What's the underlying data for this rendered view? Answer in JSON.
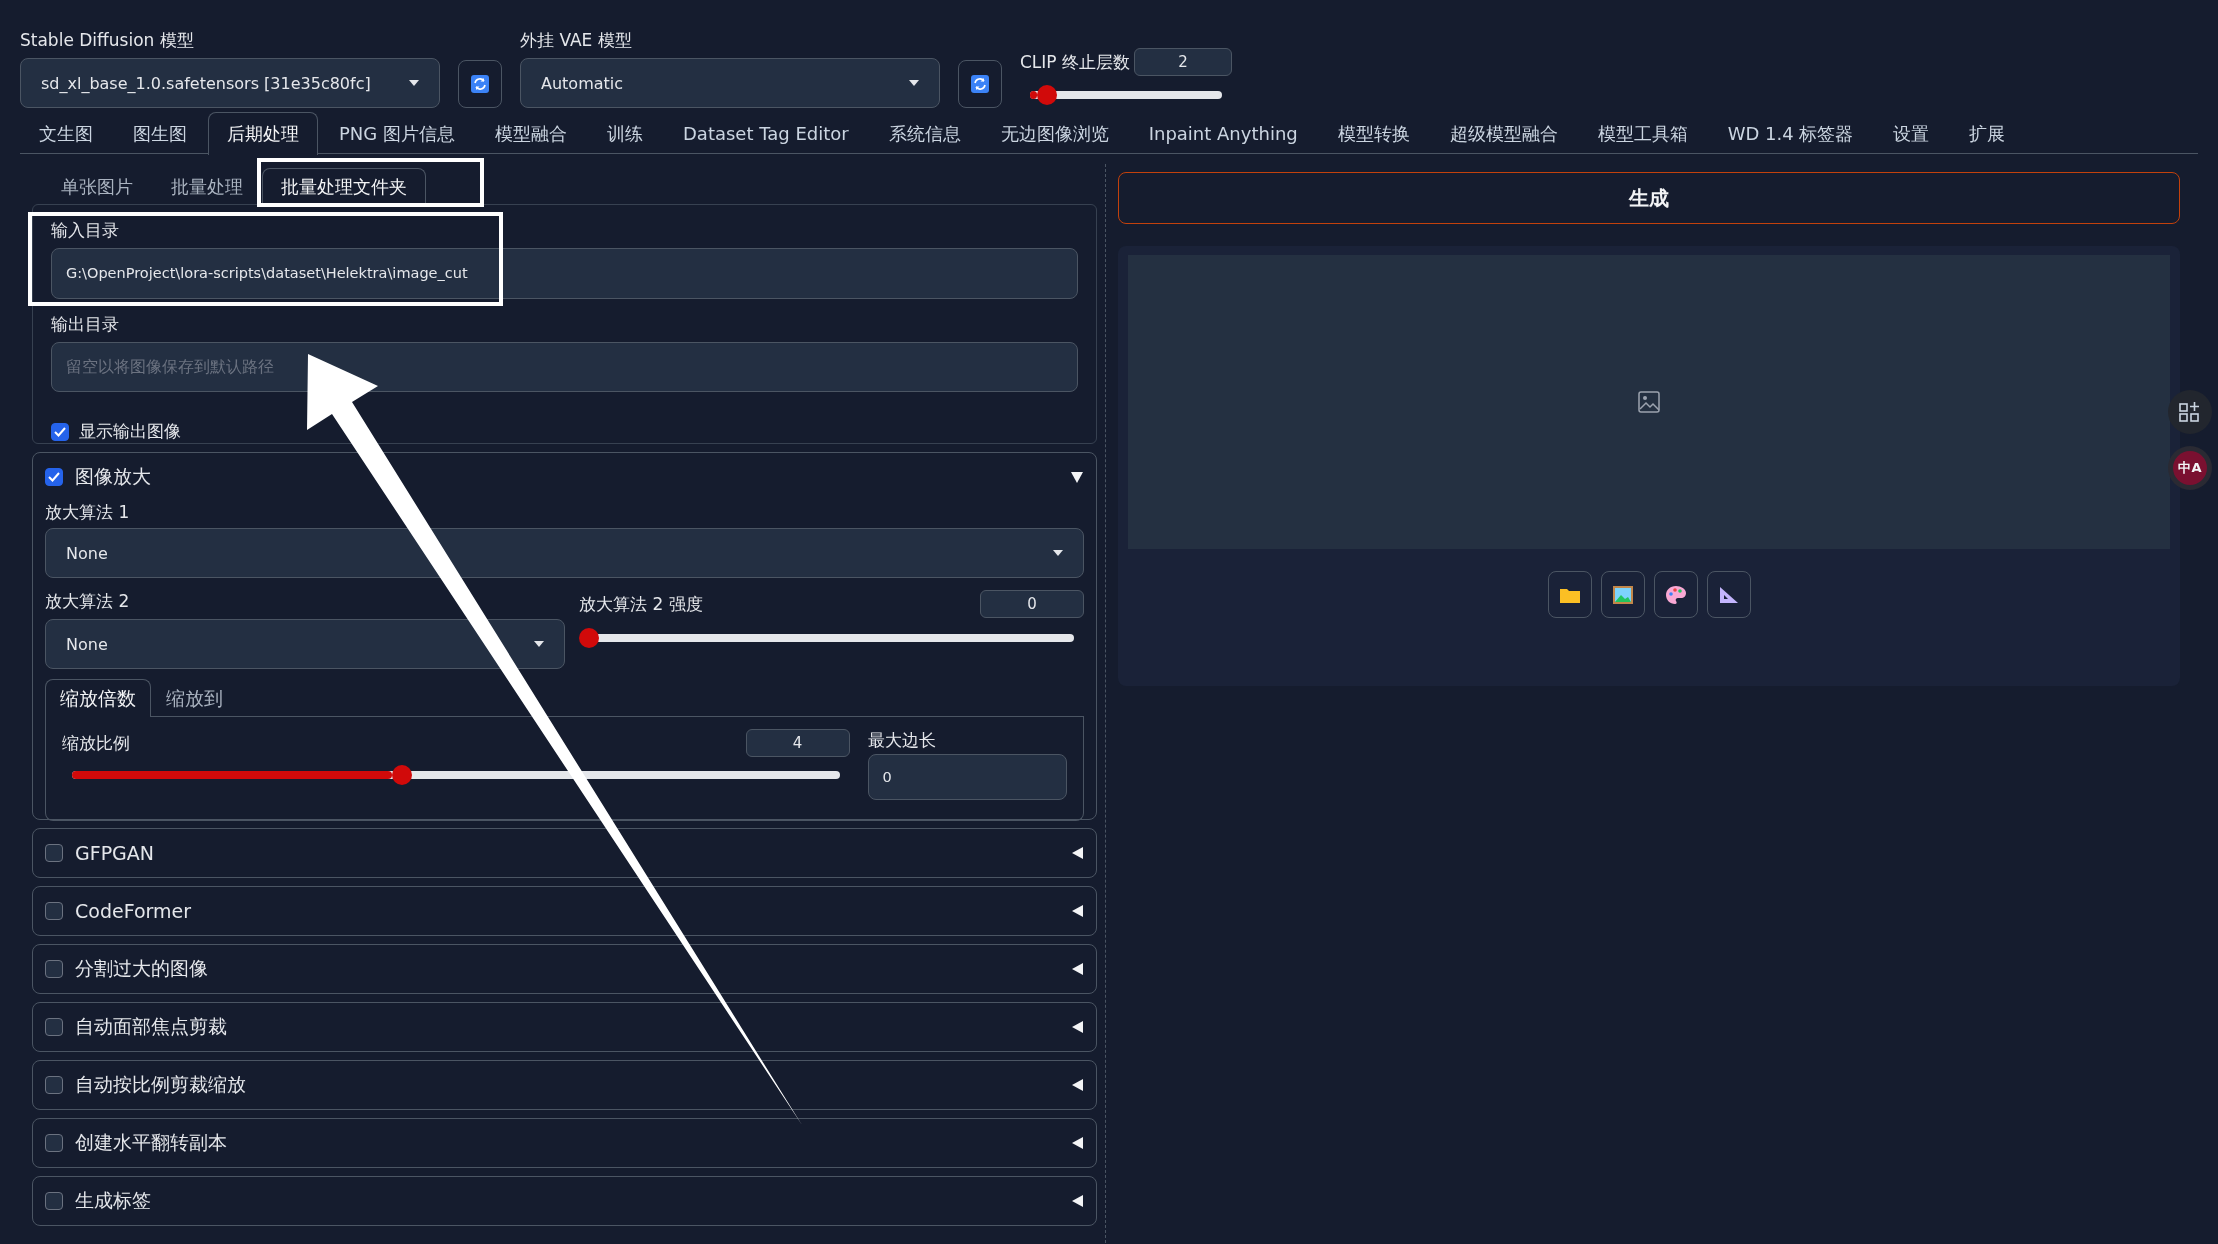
{
  "top_bar": {
    "sd_model": {
      "label": "Stable Diffusion 模型",
      "value": "sd_xl_base_1.0.safetensors [31e35c80fc]"
    },
    "vae_model": {
      "label": "外挂 VAE 模型",
      "value": "Automatic"
    },
    "clip_skip": {
      "label": "CLIP 终止层数",
      "value": "2",
      "level": 0.09
    }
  },
  "tabs": [
    {
      "label": "文生图",
      "selected": false
    },
    {
      "label": "图生图",
      "selected": false
    },
    {
      "label": "后期处理",
      "selected": true
    },
    {
      "label": "PNG 图片信息",
      "selected": false
    },
    {
      "label": "模型融合",
      "selected": false
    },
    {
      "label": "训练",
      "selected": false
    },
    {
      "label": "Dataset Tag Editor",
      "selected": false
    },
    {
      "label": "系统信息",
      "selected": false
    },
    {
      "label": "无边图像浏览",
      "selected": false
    },
    {
      "label": "Inpaint Anything",
      "selected": false
    },
    {
      "label": "模型转换",
      "selected": false
    },
    {
      "label": "超级模型融合",
      "selected": false
    },
    {
      "label": "模型工具箱",
      "selected": false
    },
    {
      "label": "WD 1.4 标签器",
      "selected": false
    },
    {
      "label": "设置",
      "selected": false
    },
    {
      "label": "扩展",
      "selected": false
    }
  ],
  "sub_tabs": [
    {
      "label": "单张图片",
      "selected": false
    },
    {
      "label": "批量处理",
      "selected": false
    },
    {
      "label": "批量处理文件夹",
      "selected": true
    }
  ],
  "input_dir": {
    "label": "输入目录",
    "value": "G:\\OpenProject\\lora-scripts\\dataset\\Helektra\\image_cut"
  },
  "output_dir": {
    "label": "输出目录",
    "placeholder": "留空以将图像保存到默认路径"
  },
  "show_output": {
    "label": "显示输出图像",
    "checked": true
  },
  "upscale": {
    "label": "图像放大",
    "checked": true,
    "expanded": true,
    "upscaler_1": {
      "label": "放大算法 1",
      "value": "None"
    },
    "upscaler_2": {
      "label": "放大算法 2",
      "value": "None"
    },
    "upscaler_2_strength": {
      "label": "放大算法 2 强度",
      "value": "0",
      "level": 0
    },
    "resize_tabs": [
      {
        "label": "缩放倍数",
        "selected": true
      },
      {
        "label": "缩放到",
        "selected": false
      }
    ],
    "scale": {
      "label": "缩放比例",
      "value": "4",
      "level": 0.43
    },
    "max_side": {
      "label": "最大边长",
      "value": "0"
    }
  },
  "sections": [
    {
      "label": "GFPGAN",
      "checked": false,
      "expanded": false
    },
    {
      "label": "CodeFormer",
      "checked": false,
      "expanded": false
    },
    {
      "label": "分割过大的图像",
      "checked": false,
      "expanded": false
    },
    {
      "label": "自动面部焦点剪裁",
      "checked": false,
      "expanded": false
    },
    {
      "label": "自动按比例剪裁缩放",
      "checked": false,
      "expanded": false
    },
    {
      "label": "创建水平翻转副本",
      "checked": false,
      "expanded": false
    },
    {
      "label": "生成标签",
      "checked": false,
      "expanded": false
    }
  ],
  "generate_button": "生成",
  "translate_badge": "中A"
}
